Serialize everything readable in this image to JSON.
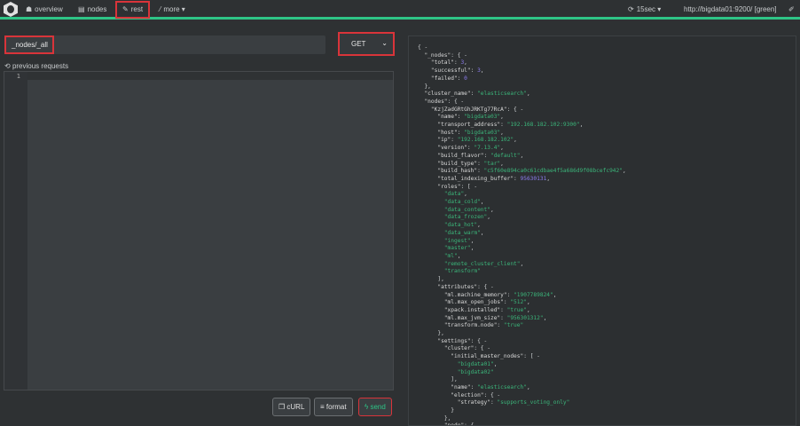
{
  "nav": {
    "items": [
      {
        "icon": "sitemap-icon",
        "label": "overview"
      },
      {
        "icon": "table-icon",
        "label": "nodes"
      },
      {
        "icon": "edit-icon",
        "label": "rest"
      },
      {
        "icon": "wand-icon",
        "label": "more ▾"
      }
    ],
    "refresh": "15sec ▾",
    "cluster_url": "http://bigdata01:9200/ [green]"
  },
  "request": {
    "path": "_nodes/_all",
    "method": "GET",
    "previous_label": "previous requests",
    "line_number": "1"
  },
  "buttons": {
    "curl": "cURL",
    "format": "format",
    "send": "send"
  },
  "colors": {
    "accent": "#2ec486",
    "highlight": "#d9343a",
    "string": "#3bb57a",
    "number": "#8c7cf0"
  },
  "response": [
    {
      "i": 0,
      "p": "{ -"
    },
    {
      "i": 1,
      "k": "_nodes",
      "p": "{ -"
    },
    {
      "i": 2,
      "k": "total",
      "v": "3",
      "t": "n",
      "p": ","
    },
    {
      "i": 2,
      "k": "successful",
      "v": "3",
      "t": "n",
      "p": ","
    },
    {
      "i": 2,
      "k": "failed",
      "v": "0",
      "t": "n",
      "p": ""
    },
    {
      "i": 1,
      "p": "},"
    },
    {
      "i": 1,
      "k": "cluster_name",
      "v": "\"elasticsearch\"",
      "t": "s",
      "p": ","
    },
    {
      "i": 1,
      "k": "nodes",
      "p": "{ -"
    },
    {
      "i": 2,
      "k": "KzjZadGRtGhJRKTg77RcA",
      "p": "{ -"
    },
    {
      "i": 3,
      "k": "name",
      "v": "\"bigdata03\"",
      "t": "s",
      "p": ","
    },
    {
      "i": 3,
      "k": "transport_address",
      "v": "\"192.168.182.102:9300\"",
      "t": "s",
      "p": ","
    },
    {
      "i": 3,
      "k": "host",
      "v": "\"bigdata03\"",
      "t": "s",
      "p": ","
    },
    {
      "i": 3,
      "k": "ip",
      "v": "\"192.168.182.102\"",
      "t": "s",
      "p": ","
    },
    {
      "i": 3,
      "k": "version",
      "v": "\"7.13.4\"",
      "t": "s",
      "p": ","
    },
    {
      "i": 3,
      "k": "build_flavor",
      "v": "\"default\"",
      "t": "s",
      "p": ","
    },
    {
      "i": 3,
      "k": "build_type",
      "v": "\"tar\"",
      "t": "s",
      "p": ","
    },
    {
      "i": 3,
      "k": "build_hash",
      "v": "\"c5f60e894ca0c61cdbae4f5a686d9f08bcefc942\"",
      "t": "s",
      "p": ","
    },
    {
      "i": 3,
      "k": "total_indexing_buffer",
      "v": "95630131",
      "t": "n",
      "p": ","
    },
    {
      "i": 3,
      "k": "roles",
      "p": "[ -"
    },
    {
      "i": 4,
      "v": "\"data\"",
      "t": "s",
      "p": ","
    },
    {
      "i": 4,
      "v": "\"data_cold\"",
      "t": "s",
      "p": ","
    },
    {
      "i": 4,
      "v": "\"data_content\"",
      "t": "s",
      "p": ","
    },
    {
      "i": 4,
      "v": "\"data_frozen\"",
      "t": "s",
      "p": ","
    },
    {
      "i": 4,
      "v": "\"data_hot\"",
      "t": "s",
      "p": ","
    },
    {
      "i": 4,
      "v": "\"data_warm\"",
      "t": "s",
      "p": ","
    },
    {
      "i": 4,
      "v": "\"ingest\"",
      "t": "s",
      "p": ","
    },
    {
      "i": 4,
      "v": "\"master\"",
      "t": "s",
      "p": ","
    },
    {
      "i": 4,
      "v": "\"ml\"",
      "t": "s",
      "p": ","
    },
    {
      "i": 4,
      "v": "\"remote_cluster_client\"",
      "t": "s",
      "p": ","
    },
    {
      "i": 4,
      "v": "\"transform\"",
      "t": "s",
      "p": ""
    },
    {
      "i": 3,
      "p": "],"
    },
    {
      "i": 3,
      "k": "attributes",
      "p": "{ -"
    },
    {
      "i": 4,
      "k": "ml.machine_memory",
      "v": "\"1907789824\"",
      "t": "s",
      "p": ","
    },
    {
      "i": 4,
      "k": "ml.max_open_jobs",
      "v": "\"512\"",
      "t": "s",
      "p": ","
    },
    {
      "i": 4,
      "k": "xpack.installed",
      "v": "\"true\"",
      "t": "s",
      "p": ","
    },
    {
      "i": 4,
      "k": "ml.max_jvm_size",
      "v": "\"956301312\"",
      "t": "s",
      "p": ","
    },
    {
      "i": 4,
      "k": "transform.node",
      "v": "\"true\"",
      "t": "s",
      "p": ""
    },
    {
      "i": 3,
      "p": "},"
    },
    {
      "i": 3,
      "k": "settings",
      "p": "{ -"
    },
    {
      "i": 4,
      "k": "cluster",
      "p": "{ -"
    },
    {
      "i": 5,
      "k": "initial_master_nodes",
      "p": "[ -"
    },
    {
      "i": 6,
      "v": "\"bigdata01\"",
      "t": "s",
      "p": ","
    },
    {
      "i": 6,
      "v": "\"bigdata02\"",
      "t": "s",
      "p": ""
    },
    {
      "i": 5,
      "p": "],"
    },
    {
      "i": 5,
      "k": "name",
      "v": "\"elasticsearch\"",
      "t": "s",
      "p": ","
    },
    {
      "i": 5,
      "k": "election",
      "p": "{ -"
    },
    {
      "i": 6,
      "k": "strategy",
      "v": "\"supports_voting_only\"",
      "t": "s",
      "p": ""
    },
    {
      "i": 5,
      "p": "}"
    },
    {
      "i": 4,
      "p": "},"
    },
    {
      "i": 4,
      "k": "node",
      "p": "{ -"
    }
  ]
}
